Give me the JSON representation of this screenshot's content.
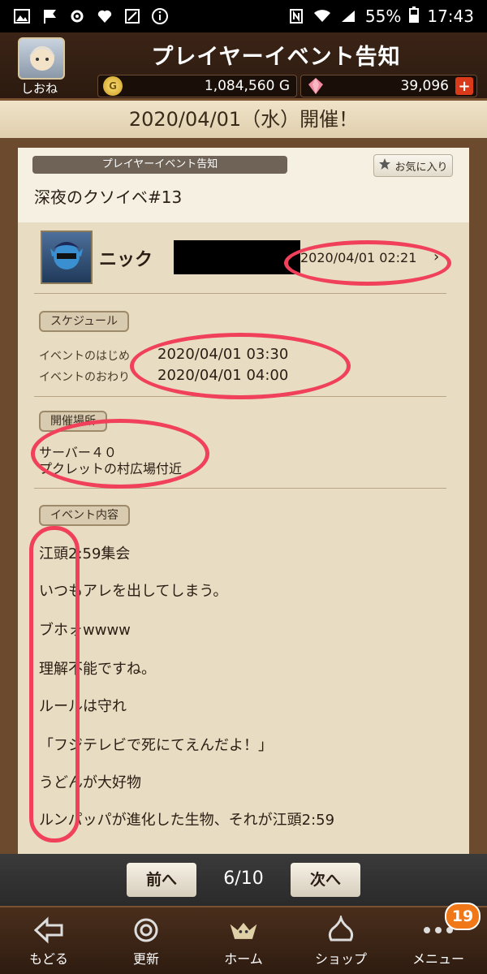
{
  "status_bar": {
    "battery": "55%",
    "time": "17:43",
    "icons": [
      "image-icon",
      "flag-icon",
      "settings-icon",
      "heart-icon",
      "box-icon",
      "info-icon",
      "nfc-icon",
      "wifi-icon",
      "signal-icon"
    ]
  },
  "header": {
    "player_name": "しおね",
    "title": "プレイヤーイベント告知",
    "gold": "1,084,560 G",
    "gems": "39,096",
    "plus_label": "+"
  },
  "date_banner": "2020/04/01（水）開催！",
  "event": {
    "category": "プレイヤーイベント告知",
    "favorite_label": "お気に入り",
    "title": "深夜のクソイベ#13",
    "poster_name": "ニック",
    "posted_at": "2020/04/01  02:21"
  },
  "schedule": {
    "section_label": "スケジュール",
    "start_label": "イベントのはじめ",
    "start_value": "2020/04/01  03:30",
    "end_label": "イベントのおわり",
    "end_value": "2020/04/01  04:00"
  },
  "location": {
    "section_label": "開催場所",
    "server": "サーバー４０",
    "place": "プクレットの村広場付近"
  },
  "content": {
    "section_label": "イベント内容",
    "lines": [
      "江頭2:59集会",
      "いつもアレを出してしまう。",
      "ブホォwwww",
      "理解不能ですね。",
      "ルールは守れ",
      "「フジテレビで死にてえんだよ！」",
      "うどんが大好物",
      "ルンパッパが進化した生物、それが江頭2:59"
    ]
  },
  "pager": {
    "prev_label": "前へ",
    "next_label": "次へ",
    "count": "6/10"
  },
  "bottom_nav": {
    "items": [
      {
        "label": "もどる",
        "icon": "back-arrow-icon"
      },
      {
        "label": "更新",
        "icon": "refresh-icon"
      },
      {
        "label": "ホーム",
        "icon": "home-monster-icon"
      },
      {
        "label": "ショップ",
        "icon": "shop-slime-icon"
      },
      {
        "label": "メニュー",
        "icon": "menu-dots-icon"
      }
    ],
    "menu_badge": "19"
  },
  "colors": {
    "annotation_red": "#f0405a",
    "parchment": "#e8dcc2",
    "frame_brown": "#6b4a2e"
  }
}
